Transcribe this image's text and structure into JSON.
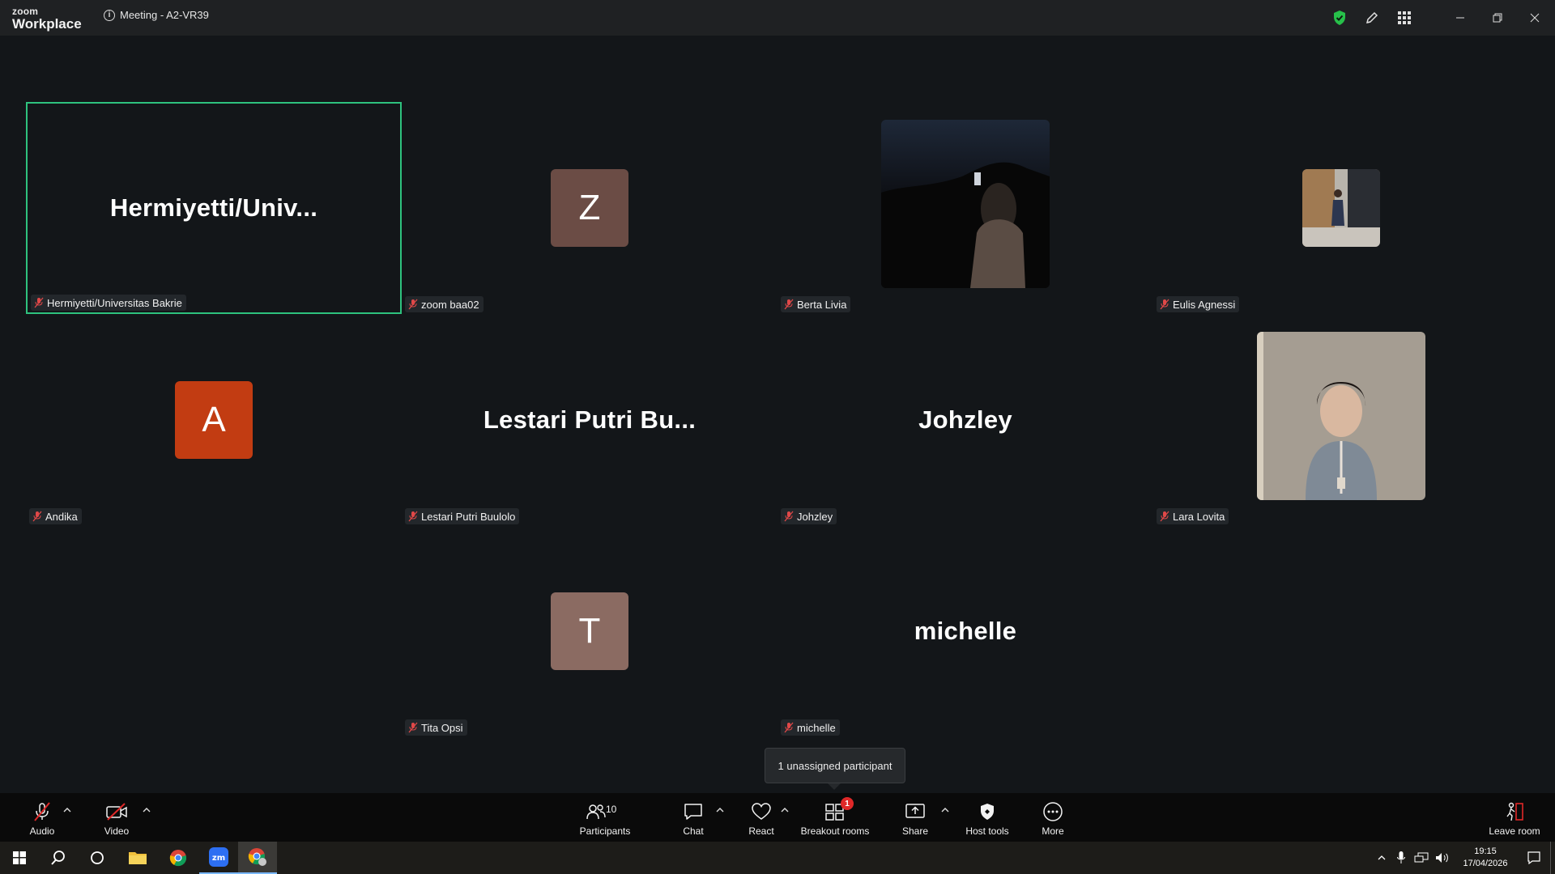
{
  "app": {
    "logo_top": "zoom",
    "logo_bottom": "Workplace",
    "meeting_title": "Meeting - A2-VR39"
  },
  "participants": [
    {
      "name": "Hermiyetti/Universitas Bakrie",
      "display": "Hermiyetti/Univ...",
      "type": "name",
      "active": true
    },
    {
      "name": "zoom baa02",
      "display": "Z",
      "type": "avatar",
      "color": "#6b4c45"
    },
    {
      "name": "Berta Livia",
      "display": "",
      "type": "photo"
    },
    {
      "name": "Eulis Agnessi",
      "display": "",
      "type": "photo"
    },
    {
      "name": "Andika",
      "display": "A",
      "type": "avatar",
      "color": "#c23c12"
    },
    {
      "name": "Lestari Putri Buulolo",
      "display": "Lestari Putri Bu...",
      "type": "name"
    },
    {
      "name": "Johzley",
      "display": "Johzley",
      "type": "name"
    },
    {
      "name": "Lara Lovita",
      "display": "",
      "type": "photo"
    },
    {
      "name": "Tita Opsi",
      "display": "T",
      "type": "avatar",
      "color": "#8b6b62"
    },
    {
      "name": "michelle",
      "display": "michelle",
      "type": "name"
    }
  ],
  "tooltip": "1 unassigned participant",
  "toolbar": {
    "audio": "Audio",
    "video": "Video",
    "participants": "Participants",
    "participants_count": "10",
    "chat": "Chat",
    "react": "React",
    "breakout": "Breakout rooms",
    "breakout_badge": "1",
    "share": "Share",
    "host_tools": "Host tools",
    "more": "More",
    "leave": "Leave room"
  },
  "taskbar": {
    "time": "19:15",
    "date": "17/04/2026"
  },
  "colors": {
    "active_speaker": "#2ec27e",
    "secure_shield": "#27c04a",
    "badge": "#e02828"
  }
}
